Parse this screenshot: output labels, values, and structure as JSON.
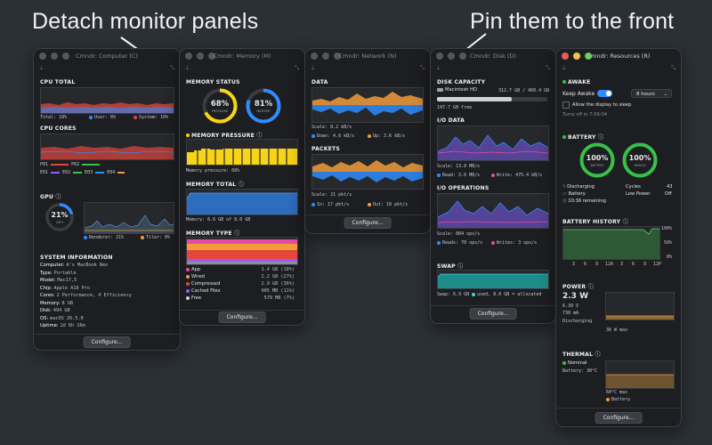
{
  "captions": {
    "left": "Detach monitor panels",
    "right": "Pin them to the front"
  },
  "colors": {
    "accent_blue": "#2f8cff",
    "orange": "#f19b3a",
    "green": "#36c24a",
    "yellow": "#f7d417",
    "red": "#e6453a",
    "pink": "#e84aa3",
    "purple": "#9b59ff"
  },
  "icons": {
    "pin": "pin-icon",
    "expand": "expand-icon"
  },
  "computer": {
    "title": "Cmndr: Computer (C)",
    "cpu_total": {
      "heading": "CPU TOTAL",
      "total": "Total: 18%",
      "user": "User: 8%",
      "system": "System: 10%"
    },
    "cpu_cores": {
      "heading": "CPU CORES",
      "cores": [
        "P01",
        "P02",
        "E01",
        "E02",
        "E03",
        "E04"
      ]
    },
    "gpu": {
      "heading": "GPU",
      "percent": "21%",
      "ring_label": "GPU",
      "renderer": "Renderer: 21%",
      "tiler": "Tiler: 0%"
    },
    "sysinfo": {
      "heading": "SYSTEM INFORMATION",
      "lines": [
        {
          "k": "Computer:",
          "v": "A's MacBook Neo"
        },
        {
          "k": "Type:",
          "v": "Portable"
        },
        {
          "k": "Model:",
          "v": "Mac17,5"
        },
        {
          "k": "Chip:",
          "v": "Apple A18 Pro"
        },
        {
          "k": "Cores:",
          "v": "2 Performance, 4 Efficiency"
        },
        {
          "k": "Memory:",
          "v": "8 GB"
        },
        {
          "k": "Disk:",
          "v": "494 GB"
        },
        {
          "k": "OS:",
          "v": "macOS 26.5.0"
        },
        {
          "k": "Uptime:",
          "v": "2d 6h 16m"
        }
      ]
    },
    "configure": "Configure..."
  },
  "memory": {
    "title": "Cmndr: Memory (M)",
    "status": {
      "heading": "MEMORY STATUS",
      "pressure_pct": "68%",
      "pressure_label": "PRESSURE",
      "memory_pct": "81%",
      "memory_label": "MEMORY",
      "pressure_fill": 0.68,
      "memory_fill": 0.81
    },
    "pressure": {
      "heading": "MEMORY PRESSURE",
      "caption": "Memory pressure: 68%"
    },
    "total": {
      "heading": "MEMORY TOTAL",
      "caption": "Memory: 6.6 GB of 8.0 GB"
    },
    "type": {
      "heading": "MEMORY TYPE",
      "rows": [
        {
          "label": "App",
          "value": "1.4 GB (18%)",
          "color": "#e84aa3"
        },
        {
          "label": "Wired",
          "value": "2.2 GB (27%)",
          "color": "#f19b3a"
        },
        {
          "label": "Compressed",
          "value": "2.9 GB (36%)",
          "color": "#e6453a"
        },
        {
          "label": "Cached Files",
          "value": "905 MB (11%)",
          "color": "#9b59ff"
        },
        {
          "label": "Free",
          "value": "579 MB (7%)",
          "color": "#cfd1d4"
        }
      ]
    },
    "configure": "Configure..."
  },
  "network": {
    "title": "Cmndr: Network (N)",
    "data": {
      "heading": "DATA",
      "scale": "Scale: 8.2 kB/s",
      "down": "Down: 4.6 kB/s",
      "up": "Up: 3.6 kB/s"
    },
    "packets": {
      "heading": "PACKETS",
      "scale": "Scale: 21 pkt/s",
      "in": "In: 17 pkt/s",
      "out": "Out: 18 pkt/s"
    },
    "configure": "Configure..."
  },
  "disk": {
    "title": "Cmndr: Disk (D)",
    "capacity": {
      "heading": "DISK CAPACITY",
      "name": "Macintosh HD",
      "usage": "312.7 GB / 460.4 GB",
      "free": "147.7 GB free",
      "used_fraction": 0.68
    },
    "io_data": {
      "heading": "I/O DATA",
      "scale": "Scale: 13.8 MB/s",
      "read": "Read: 3.6 MB/s",
      "write": "Write: 475.4 kB/s"
    },
    "io_ops": {
      "heading": "I/O OPERATIONS",
      "scale": "Scale: 804 ops/s",
      "reads": "Reads: 70 ops/s",
      "writes": "Writes: 3 ops/s"
    },
    "swap": {
      "heading": "SWAP",
      "used": "Swap: 6.9 GB",
      "used_label": "used,",
      "allocated": "8.0 GB = allocated"
    },
    "configure": "Configure..."
  },
  "resources": {
    "title": "Cmndr: Resources (R)",
    "awake": {
      "heading": "AWAKE",
      "keep_awake": "Keep Awake",
      "duration": "8 hours",
      "allow_sleep": "Allow the display to sleep",
      "turns_off": "Turns off in 7:56:04"
    },
    "battery": {
      "heading": "BATTERY",
      "battery_pct": "100%",
      "battery_label": "BATTERY",
      "health_pct": "100%",
      "health_label": "HEALTH",
      "status": "Discharging",
      "battery_word": "Battery",
      "remaining": "10:36 remaining",
      "cycles_label": "Cycles",
      "cycles": "43",
      "low_power_label": "Low Power",
      "low_power": "Off"
    },
    "history": {
      "heading": "BATTERY HISTORY",
      "ylabels": [
        "100%",
        "50%",
        "0%"
      ],
      "xlabels": [
        "3",
        "6",
        "9",
        "12A",
        "3",
        "6",
        "9",
        "12P"
      ]
    },
    "power": {
      "heading": "POWER",
      "watts": "2.3 W",
      "volts": "6.39 V",
      "amps": "730 mA",
      "state": "Discharging",
      "max": "36 W max"
    },
    "thermal": {
      "heading": "THERMAL",
      "nominal": "Nominal",
      "battery_temp": "Battery: 30°C",
      "max": "60°C max",
      "legend": "Battery"
    },
    "configure": "Configure..."
  }
}
